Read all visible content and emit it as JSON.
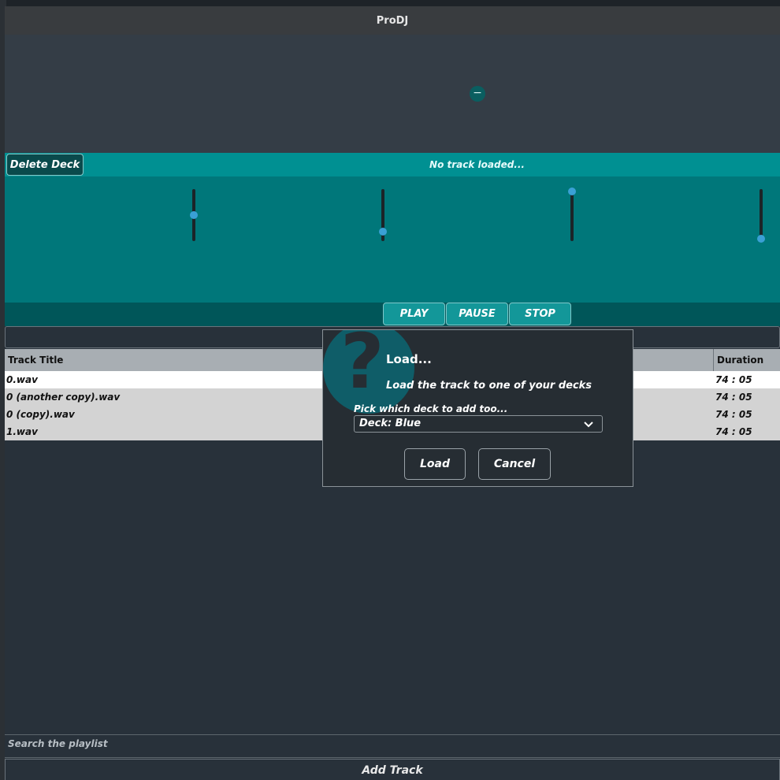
{
  "window": {
    "title": "ProDJ"
  },
  "deck": {
    "delete_label": "Delete Deck",
    "status": "No track loaded...",
    "remove_icon": "minus-icon",
    "sliders": [
      0.5,
      0.15,
      1.0,
      0.0
    ]
  },
  "transport": {
    "play": "PLAY",
    "pause": "PAUSE",
    "stop": "STOP"
  },
  "playlist": {
    "columns": {
      "title": "Track Title",
      "duration": "Duration"
    },
    "rows": [
      {
        "title": "0.wav",
        "duration": "74 : 05"
      },
      {
        "title": "0 (another copy).wav",
        "duration": "74 : 05"
      },
      {
        "title": "0 (copy).wav",
        "duration": "74 : 05"
      },
      {
        "title": "1.wav",
        "duration": "74 : 05"
      }
    ],
    "search_placeholder": "Search the playlist",
    "add_track": "Add Track"
  },
  "dialog": {
    "icon": "question-icon",
    "icon_glyph": "?",
    "title": "Load...",
    "message": "Load the track to one of your decks",
    "pick_label": "Pick which deck to add too...",
    "selected_deck": "Deck: Blue",
    "load": "Load",
    "cancel": "Cancel"
  },
  "colors": {
    "deck_header": "#009092",
    "deck_body": "#00777a",
    "transport_bar": "#005659",
    "slider_knob": "#3aa0d5",
    "background": "#28313a"
  }
}
